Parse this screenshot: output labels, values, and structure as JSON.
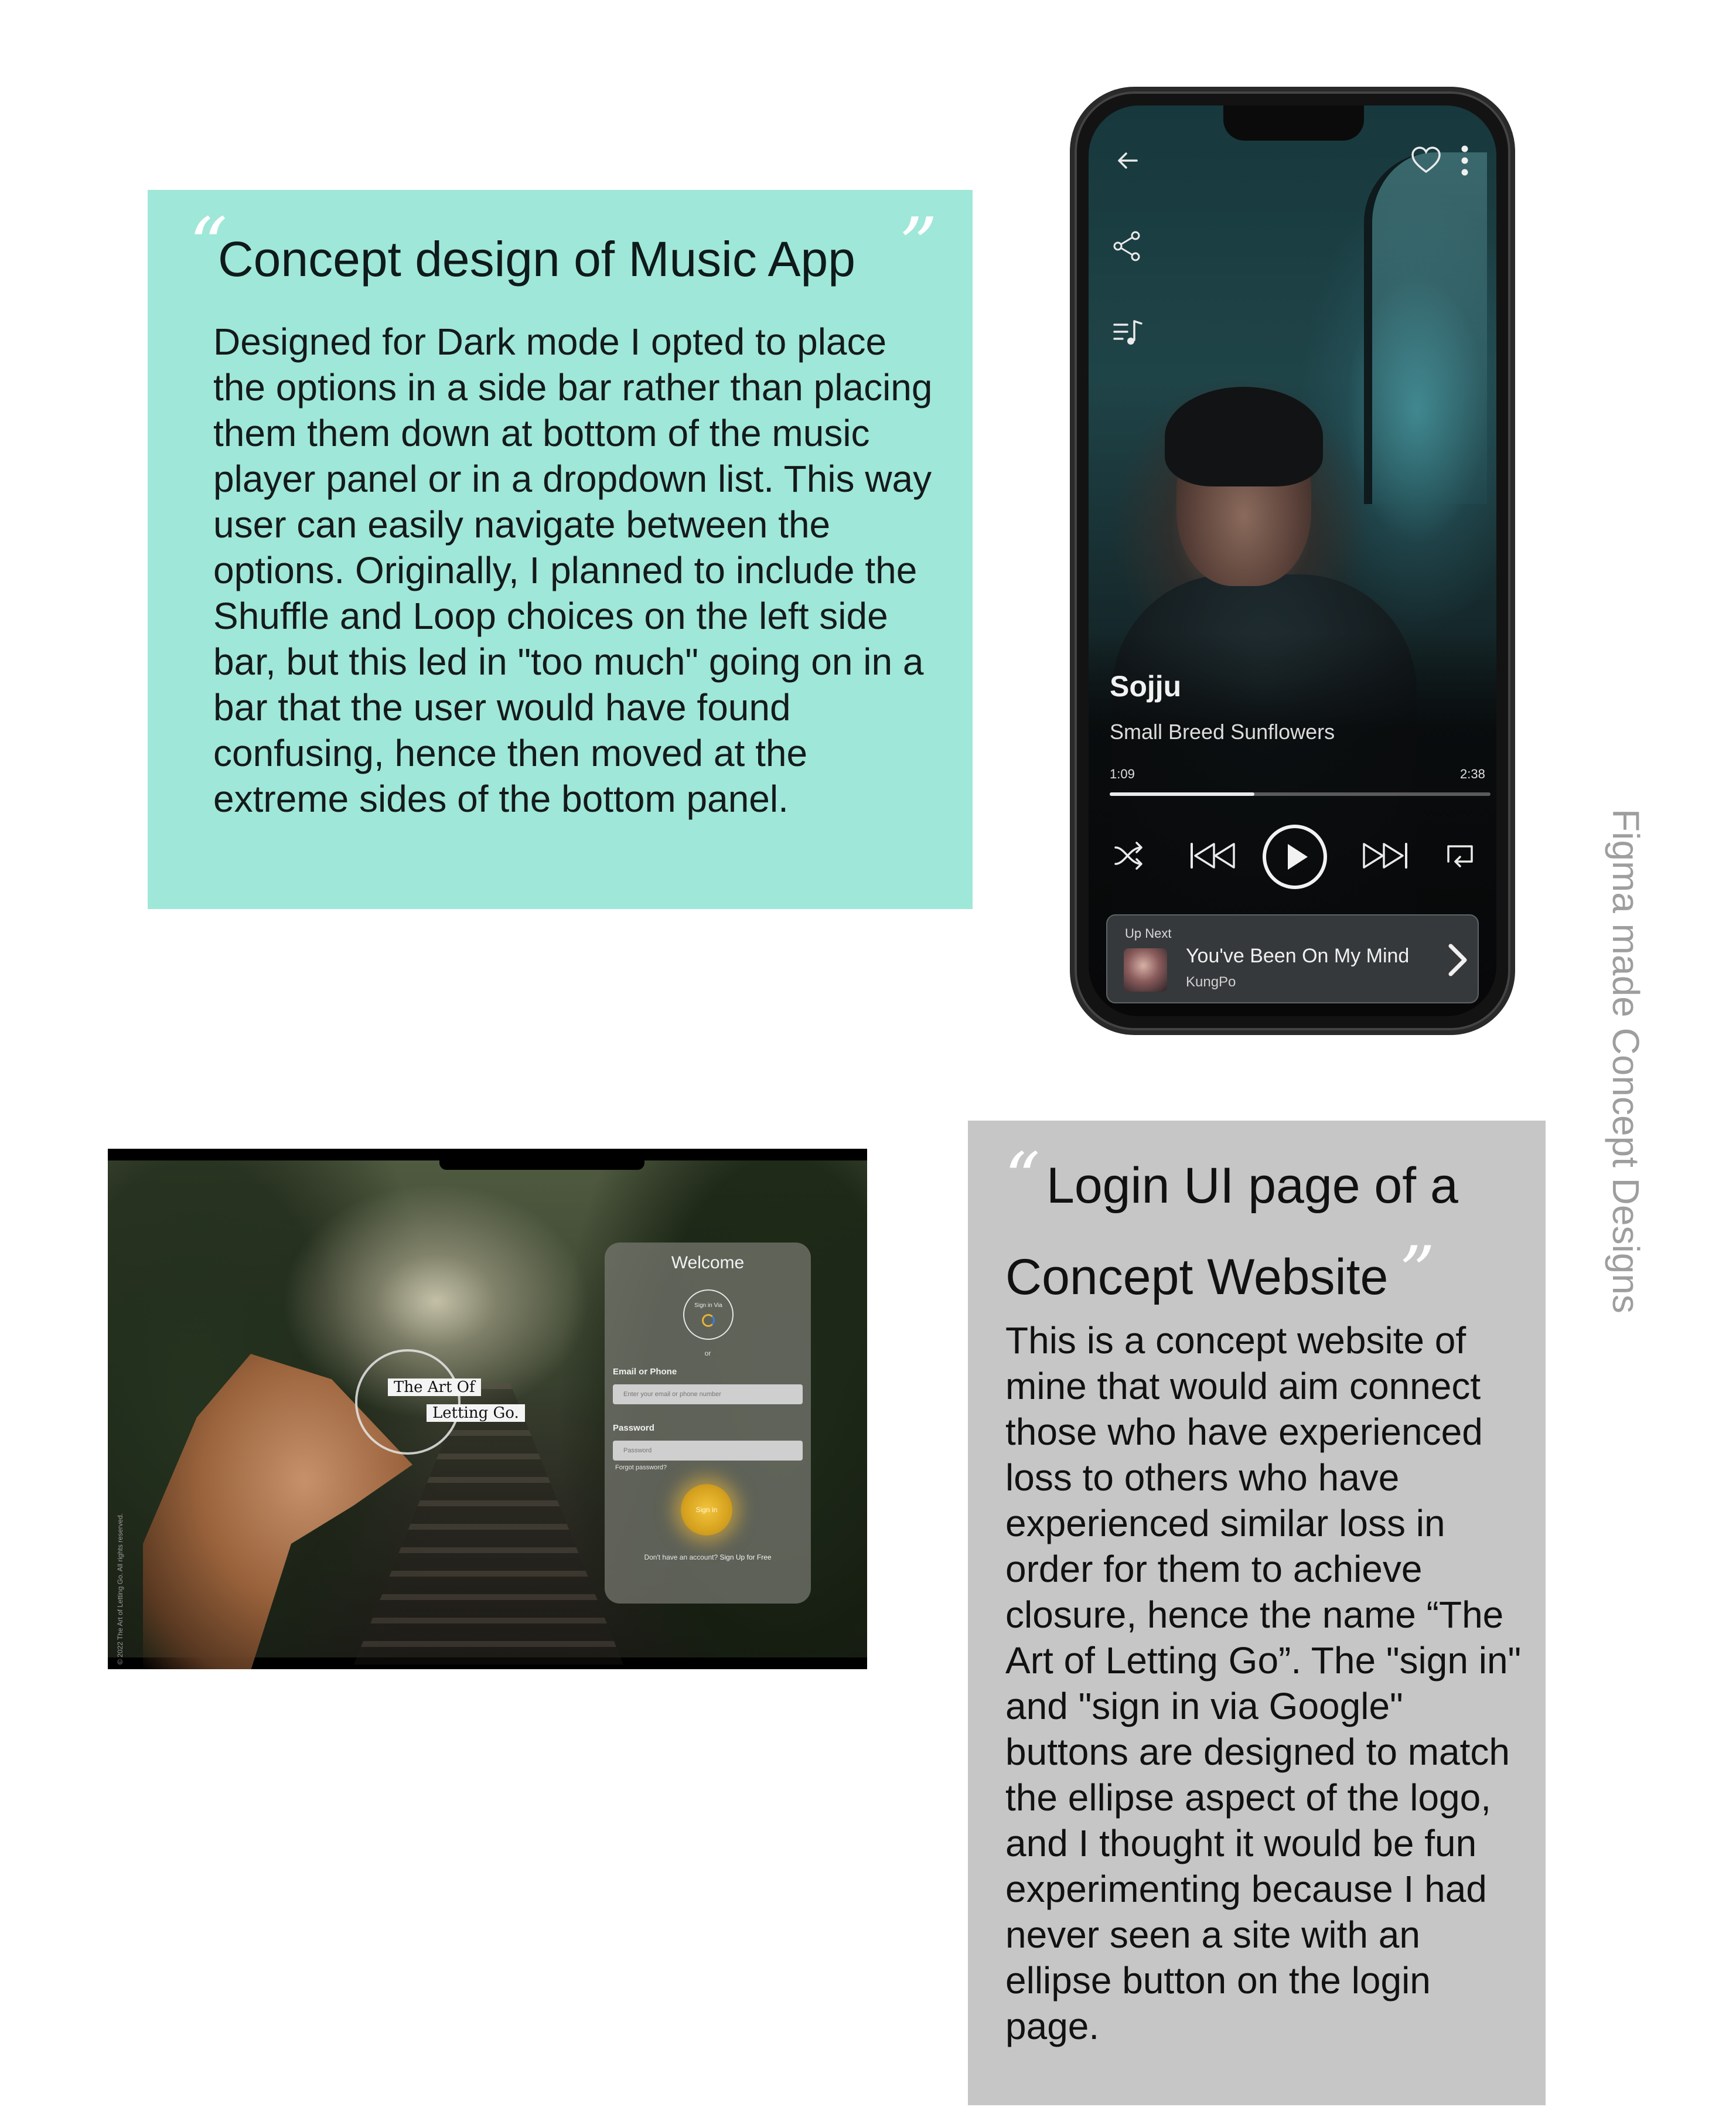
{
  "music_card": {
    "title": "Concept design of Music App",
    "open_quote": "“",
    "close_quote": "”",
    "body": "Designed for Dark mode I opted to place the options in a side bar rather than placing them them down at bottom of the music player panel or in a dropdown list. This way user can easily navigate between the options. Originally, I planned to include the Shuffle and Loop choices on the left side bar, but this led in \"too much\" going on in a bar that the user would have found confusing, hence then moved at the extreme sides of the bottom panel."
  },
  "music_app": {
    "icons": {
      "back": "back-arrow-icon",
      "favorite": "heart-icon",
      "more": "more-vertical-icon",
      "share": "share-icon",
      "queue": "playlist-icon"
    },
    "song": {
      "title": "Sojju",
      "artist": "Small Breed Sunflowers",
      "current_time": "1:09",
      "total_time": "2:38",
      "progress_fraction": 0.38
    },
    "controls": [
      "shuffle-icon",
      "previous-icon",
      "play-icon",
      "next-icon",
      "repeat-icon"
    ],
    "up_next": {
      "label": "Up Next",
      "title": "You've Been On My Mind",
      "artist": "KungPo"
    }
  },
  "side_caption": "Figma made Concept Designs",
  "login_site": {
    "logo_line1": "The Art Of",
    "logo_line2": "Letting Go.",
    "welcome": "Welcome",
    "google_label": "Sign in Via",
    "or_label": "or",
    "email_label": "Email or Phone",
    "email_placeholder": "Enter your email or phone number",
    "password_label": "Password",
    "password_placeholder": "Password",
    "forgot_label": "Forgot password?",
    "signin_label": "Sign in",
    "signup_prompt": "Don't have an account?",
    "signup_link": "Sign Up for Free",
    "copyright": "© 2022 The Art of Letting Go. All rights reserved."
  },
  "login_card": {
    "open_quote": "“",
    "close_quote": "”",
    "title_line1": "Login UI page of a",
    "title_line2": "Concept Website",
    "body": "This is a concept website of mine that would aim connect those who have experienced loss to others who have experienced similar loss in order for them to achieve closure, hence the name “The Art of Letting Go”. The \"sign in\" and \"sign in via Google\" buttons are designed to match the ellipse aspect of the logo, and I thought it would be fun experimenting because I had never seen a site with an ellipse button on the login page."
  },
  "colors": {
    "teal_card": "#9fe7d9",
    "grey_card": "#c6c6c6",
    "signin_accent": "#e6b33a",
    "caption_grey": "#9e9e9e"
  }
}
